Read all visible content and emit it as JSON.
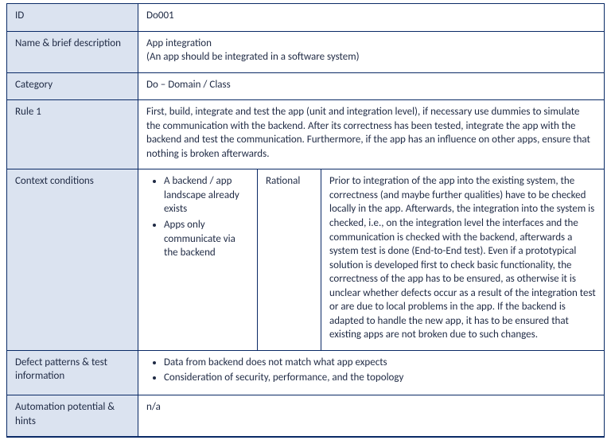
{
  "labels": {
    "id": "ID",
    "name_desc": "Name & brief description",
    "category": "Category",
    "rule1": "Rule 1",
    "context": "Context conditions",
    "rational": "Rational",
    "defect": "Defect patterns & test information",
    "automation": "Automation potential & hints"
  },
  "values": {
    "id": "Do001",
    "name": "App integration",
    "name_desc_sub": "(An app should be integrated in a software system)",
    "category": "Do – Domain / Class",
    "rule1": "First, build, integrate and test the app (unit and integration level), if necessary use dummies to simulate the communication with the backend. After its correctness has been tested, integrate the app with the backend and test the communication. Furthermore, if the app has an influence on other apps, ensure that nothing is broken afterwards.",
    "context_items": [
      "A backend / app landscape already exists",
      "Apps only communicate via the backend"
    ],
    "rational_text": "Prior to integration of the app into the existing system, the correctness (and maybe further qualities) have to be checked locally in the app. Afterwards, the integration into the system is checked, i.e., on the integration level the interfaces and the communication is checked with the backend, afterwards a system test is done (End-to-End test). Even if a prototypical solution is developed first to check basic functionality, the correctness of the app has to be ensured, as otherwise it is unclear whether defects occur as a result of the integration test or are due to local problems in the app. If the backend is adapted to handle the new app, it has to be ensured that existing apps are not broken due to such changes.",
    "defect_items": [
      "Data from backend does not match what app expects",
      "Consideration of security, performance, and the topology"
    ],
    "automation": "n/a"
  }
}
